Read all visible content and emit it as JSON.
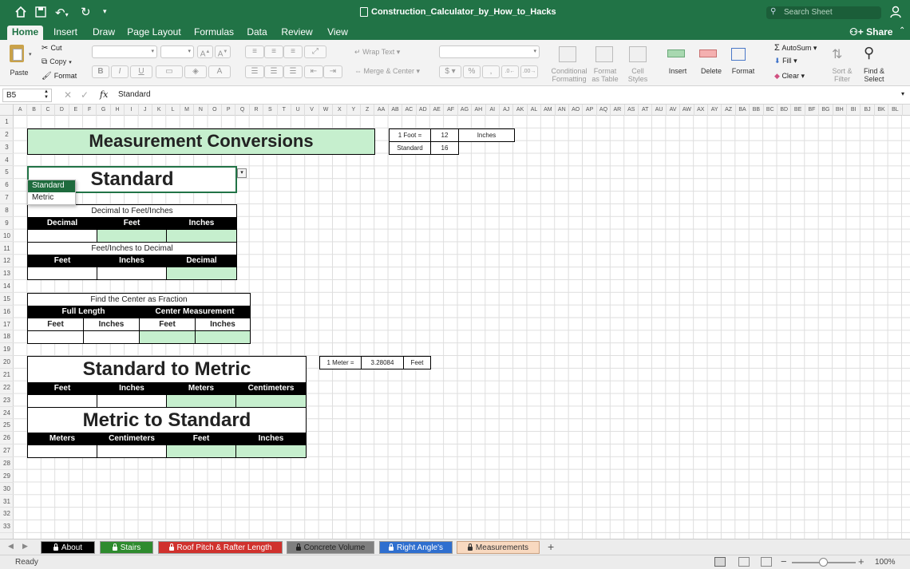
{
  "window": {
    "title": "Construction_Calculator_by_How_to_Hacks",
    "search_placeholder": "Search Sheet",
    "share_label": "Share"
  },
  "ribbon_tabs": [
    "Home",
    "Insert",
    "Draw",
    "Page Layout",
    "Formulas",
    "Data",
    "Review",
    "View"
  ],
  "ribbon": {
    "paste": "Paste",
    "cut": "Cut",
    "copy": "Copy",
    "format": "Format",
    "bold": "B",
    "italic": "I",
    "underline": "U",
    "wrap_text": "Wrap Text",
    "merge_center": "Merge & Center",
    "cond_format_1": "Conditional",
    "cond_format_2": "Formatting",
    "format_table_1": "Format",
    "format_table_2": "as Table",
    "cell_styles_1": "Cell",
    "cell_styles_2": "Styles",
    "insert": "Insert",
    "delete": "Delete",
    "format_cells": "Format",
    "autosum": "AutoSum",
    "fill": "Fill",
    "clear": "Clear",
    "sort_1": "Sort &",
    "sort_2": "Filter",
    "find_1": "Find &",
    "find_2": "Select"
  },
  "formula_bar": {
    "name_box": "B5",
    "fx": "fx",
    "value": "Standard"
  },
  "columns": [
    "A",
    "B",
    "C",
    "D",
    "E",
    "F",
    "G",
    "H",
    "I",
    "J",
    "K",
    "L",
    "M",
    "N",
    "O",
    "P",
    "Q",
    "R",
    "S",
    "T",
    "U",
    "V",
    "W",
    "X",
    "Y",
    "Z",
    "AA",
    "AB",
    "AC",
    "AD",
    "AE",
    "AF",
    "AG",
    "AH",
    "AI",
    "AJ",
    "AK",
    "AL",
    "AM",
    "AN",
    "AO",
    "AP",
    "AQ",
    "AR",
    "AS",
    "AT",
    "AU",
    "AV",
    "AW",
    "AX",
    "AY",
    "AZ",
    "BA",
    "BB",
    "BC",
    "BD",
    "BE",
    "BF",
    "BG",
    "BH",
    "BI",
    "BJ",
    "BK",
    "BL"
  ],
  "rows": [
    "1",
    "2",
    "3",
    "4",
    "5",
    "6",
    "7",
    "8",
    "9",
    "10",
    "11",
    "12",
    "13",
    "14",
    "15",
    "16",
    "17",
    "18",
    "19",
    "20",
    "21",
    "22",
    "23",
    "24",
    "25",
    "26",
    "27",
    "28",
    "29",
    "30",
    "31",
    "32",
    "33"
  ],
  "sheet": {
    "main_title": "Measurement Conversions",
    "unit_select": "Standard",
    "dropdown_options": [
      "Standard",
      "Metric"
    ],
    "foot_table": {
      "c1": "1 Foot =",
      "c2": "12",
      "c3": "Inches",
      "c4": "Standard",
      "c5": "16"
    },
    "dec_to_ft": {
      "title": "Decimal to Feet/Inches",
      "h1": "Decimal",
      "h2": "Feet",
      "h3": "Inches"
    },
    "ft_to_dec": {
      "title": "Feet/Inches to Decimal",
      "h1": "Feet",
      "h2": "Inches",
      "h3": "Decimal"
    },
    "center": {
      "title": "Find the Center as Fraction",
      "g1": "Full Length",
      "g2": "Center Measurement",
      "h1": "Feet",
      "h2": "Inches",
      "h3": "Feet",
      "h4": "Inches"
    },
    "std_to_metric": {
      "title": "Standard to Metric",
      "h1": "Feet",
      "h2": "Inches",
      "h3": "Meters",
      "h4": "Centimeters"
    },
    "metric_to_std": {
      "title": "Metric to Standard",
      "h1": "Meters",
      "h2": "Centimeters",
      "h3": "Feet",
      "h4": "Inches"
    },
    "meter_table": {
      "c1": "1 Meter =",
      "c2": "3.28084",
      "c3": "Feet"
    }
  },
  "sheet_tabs": [
    {
      "label": "About",
      "color": "#000000"
    },
    {
      "label": "Stairs",
      "color": "#2e8b2e"
    },
    {
      "label": "Roof Pitch & Rafter Length",
      "color": "#d0312d"
    },
    {
      "label": "Concrete Volume",
      "color": "#7f7f7f"
    },
    {
      "label": "Right Angle's",
      "color": "#2f6fcf"
    },
    {
      "label": "Measurements",
      "color": "#f8d9c0"
    }
  ],
  "status": {
    "ready": "Ready",
    "zoom": "100%"
  }
}
